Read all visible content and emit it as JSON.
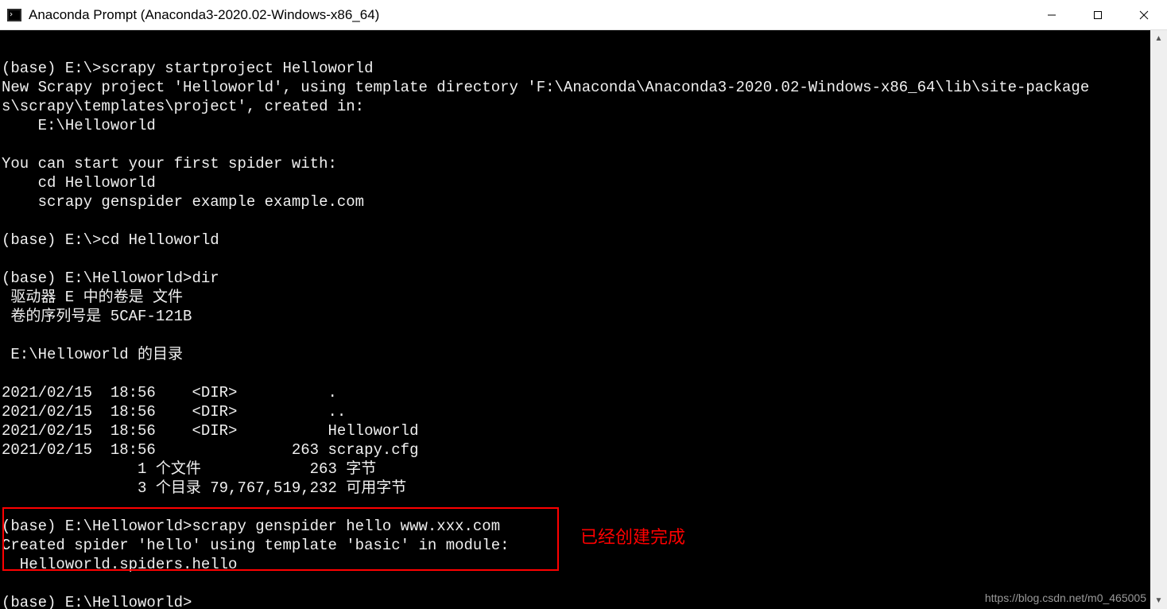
{
  "titlebar": {
    "title": "Anaconda Prompt (Anaconda3-2020.02-Windows-x86_64)"
  },
  "terminal": {
    "lines": [
      "",
      "(base) E:\\>scrapy startproject Helloworld",
      "New Scrapy project 'Helloworld', using template directory 'F:\\Anaconda\\Anaconda3-2020.02-Windows-x86_64\\lib\\site-package",
      "s\\scrapy\\templates\\project', created in:",
      "    E:\\Helloworld",
      "",
      "You can start your first spider with:",
      "    cd Helloworld",
      "    scrapy genspider example example.com",
      "",
      "(base) E:\\>cd Helloworld",
      "",
      "(base) E:\\Helloworld>dir",
      " 驱动器 E 中的卷是 文件",
      " 卷的序列号是 5CAF-121B",
      "",
      " E:\\Helloworld 的目录",
      "",
      "2021/02/15  18:56    <DIR>          .",
      "2021/02/15  18:56    <DIR>          ..",
      "2021/02/15  18:56    <DIR>          Helloworld",
      "2021/02/15  18:56               263 scrapy.cfg",
      "               1 个文件            263 字节",
      "               3 个目录 79,767,519,232 可用字节",
      "",
      "(base) E:\\Helloworld>scrapy genspider hello www.xxx.com",
      "Created spider 'hello' using template 'basic' in module:",
      "  Helloworld.spiders.hello",
      "",
      "(base) E:\\Helloworld>"
    ]
  },
  "annotation": {
    "label": "已经创建完成"
  },
  "watermark": "https://blog.csdn.net/m0_465005"
}
